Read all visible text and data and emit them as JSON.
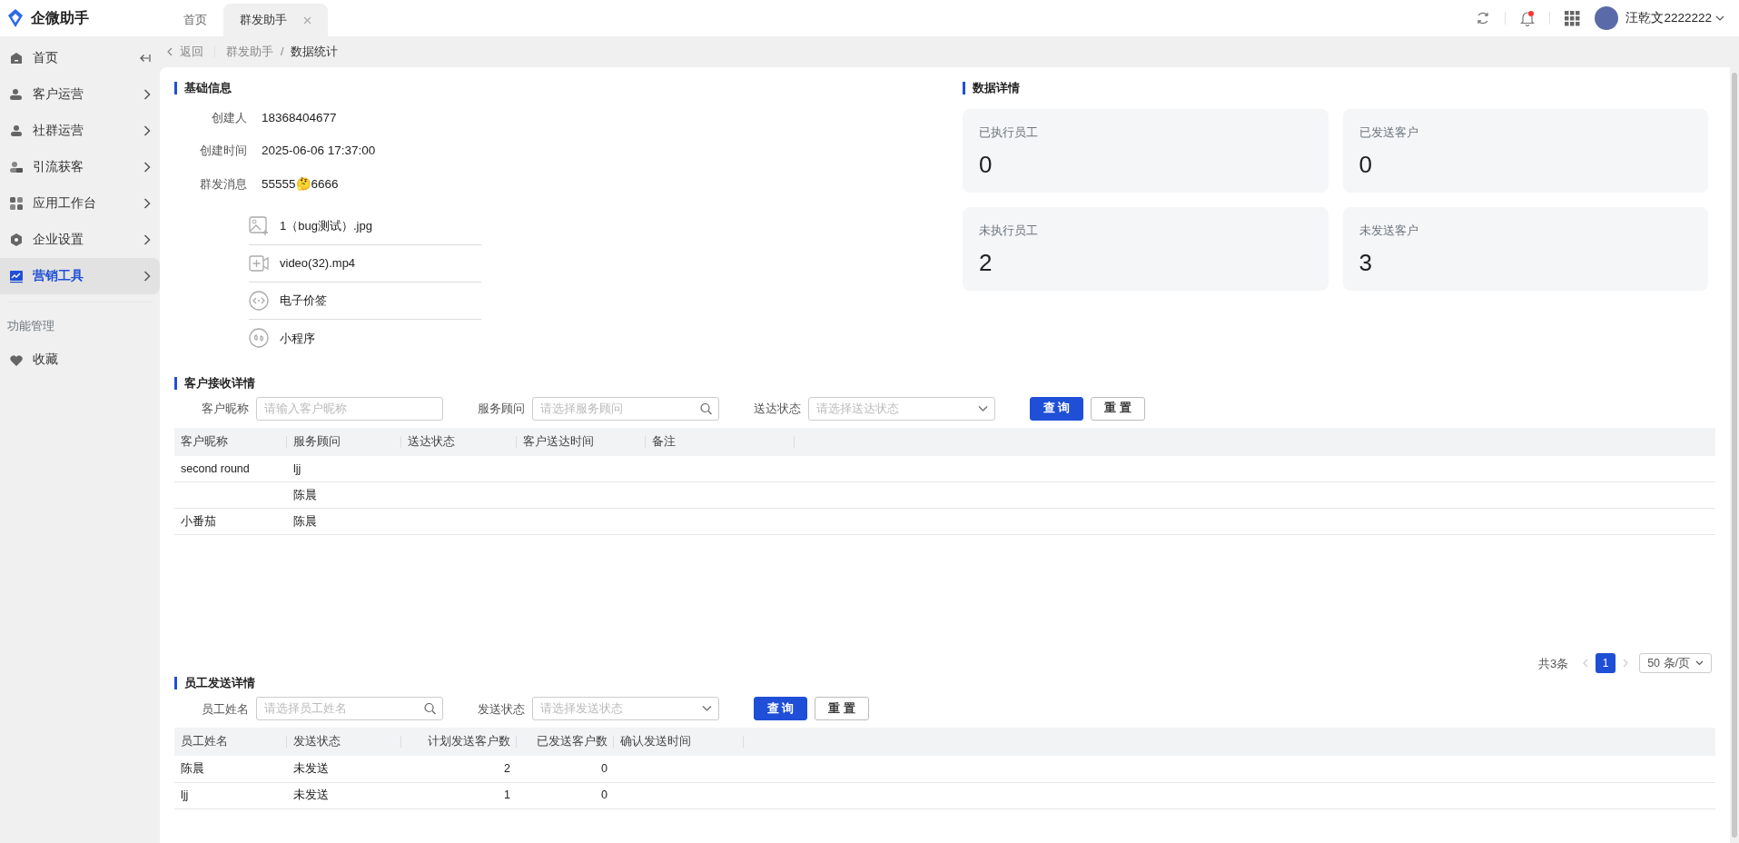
{
  "app": {
    "name": "企微助手"
  },
  "tabs": [
    {
      "label": "首页",
      "selected": false,
      "closable": false
    },
    {
      "label": "群发助手",
      "selected": true,
      "closable": true
    }
  ],
  "header": {
    "user_name": "汪乾文2222222",
    "unread_notifications": true
  },
  "sidebar": {
    "items": [
      {
        "label": "首页",
        "expandable": false,
        "selected": false
      },
      {
        "label": "客户运营",
        "expandable": true,
        "selected": false
      },
      {
        "label": "社群运营",
        "expandable": true,
        "selected": false
      },
      {
        "label": "引流获客",
        "expandable": true,
        "selected": false
      },
      {
        "label": "应用工作台",
        "expandable": true,
        "selected": false
      },
      {
        "label": "企业设置",
        "expandable": true,
        "selected": false
      },
      {
        "label": "营销工具",
        "expandable": true,
        "selected": true
      }
    ],
    "section_title": "功能管理",
    "extra_items": [
      {
        "label": "收藏",
        "expandable": false,
        "selected": false
      }
    ]
  },
  "breadcrumb": {
    "back": "返回",
    "path": [
      "群发助手",
      "数据统计"
    ],
    "separator": "/"
  },
  "basic_info": {
    "title": "基础信息",
    "fields": [
      {
        "label": "创建人",
        "value": "18368404677"
      },
      {
        "label": "创建时间",
        "value": "2025-06-06 17:37:00"
      },
      {
        "label": "群发消息",
        "value": "55555🤔6666"
      }
    ],
    "attachments": [
      {
        "kind": "image",
        "name": "1（bug测试）.jpg"
      },
      {
        "kind": "video",
        "name": "video(32).mp4"
      },
      {
        "kind": "link",
        "name": "电子价签"
      },
      {
        "kind": "miniprogram",
        "name": "小程序"
      }
    ]
  },
  "data_details": {
    "title": "数据详情",
    "stats": [
      {
        "label": "已执行员工",
        "value": "0"
      },
      {
        "label": "已发送客户",
        "value": "0"
      },
      {
        "label": "未执行员工",
        "value": "2"
      },
      {
        "label": "未发送客户",
        "value": "3"
      }
    ]
  },
  "customer_section": {
    "title": "客户接收详情",
    "filters": [
      {
        "label": "客户昵称",
        "placeholder": "请输入客户昵称",
        "kind": "text"
      },
      {
        "label": "服务顾问",
        "placeholder": "请选择服务顾问",
        "kind": "search"
      },
      {
        "label": "送达状态",
        "placeholder": "请选择送达状态",
        "kind": "select"
      }
    ],
    "buttons": [
      {
        "label": "查 询",
        "kind": "primary"
      },
      {
        "label": "重 置",
        "kind": "default"
      }
    ],
    "table": {
      "columns": [
        {
          "label": "客户昵称",
          "kind": "text"
        },
        {
          "label": "服务顾问",
          "kind": "text"
        },
        {
          "label": "送达状态",
          "kind": "text"
        },
        {
          "label": "客户送达时间",
          "kind": "text"
        },
        {
          "label": "备注",
          "kind": "text"
        }
      ],
      "rows": [
        [
          "second round",
          "ljj",
          "",
          "",
          ""
        ],
        [
          "",
          "陈晨",
          "",
          "",
          ""
        ],
        [
          "小番茄",
          "陈晨",
          "",
          "",
          ""
        ]
      ]
    },
    "pagination": {
      "total": "共3条",
      "pages": [
        {
          "label": "1",
          "selected": true
        }
      ],
      "page_size": "50 条/页"
    }
  },
  "employee_section": {
    "title": "员工发送详情",
    "filters": [
      {
        "label": "员工姓名",
        "placeholder": "请选择员工姓名",
        "kind": "search"
      },
      {
        "label": "发送状态",
        "placeholder": "请选择发送状态",
        "kind": "select"
      }
    ],
    "buttons": [
      {
        "label": "查 询",
        "kind": "primary"
      },
      {
        "label": "重 置",
        "kind": "default"
      }
    ],
    "table": {
      "columns": [
        {
          "label": "员工姓名",
          "kind": "text"
        },
        {
          "label": "发送状态",
          "kind": "text"
        },
        {
          "label": "计划发送客户数",
          "kind": "number"
        },
        {
          "label": "已发送客户数",
          "kind": "number"
        },
        {
          "label": "确认发送时间",
          "kind": "text"
        }
      ],
      "rows": [
        [
          "陈晨",
          "未发送",
          "2",
          "0",
          ""
        ],
        [
          "ljj",
          "未发送",
          "1",
          "0",
          ""
        ]
      ]
    }
  }
}
